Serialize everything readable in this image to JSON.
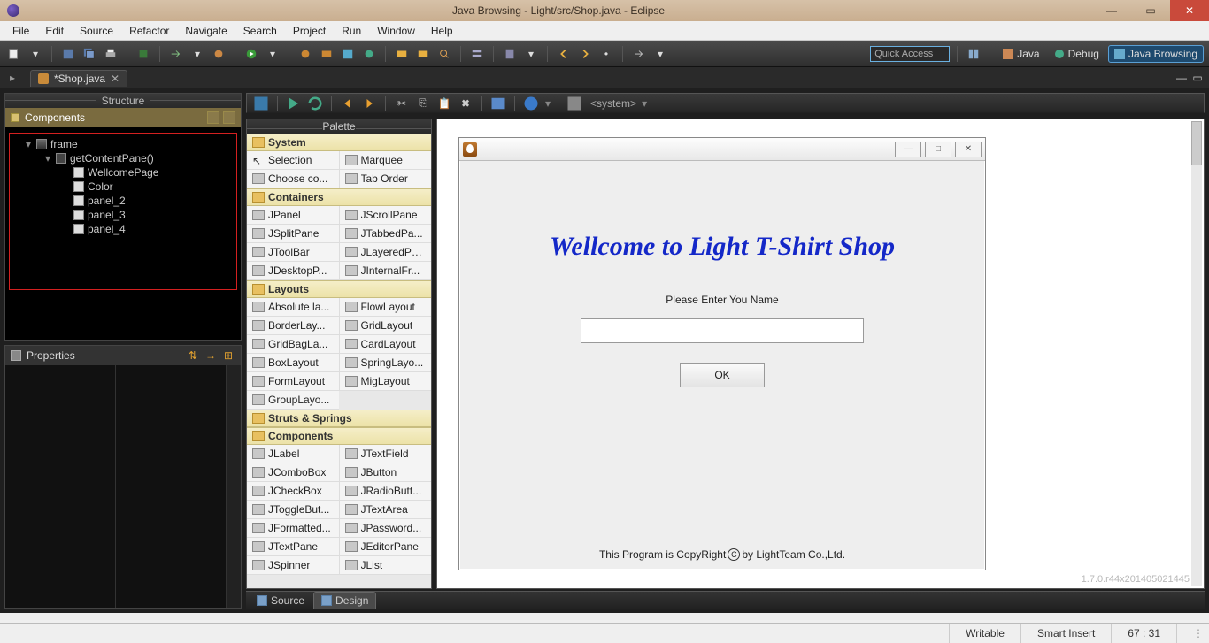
{
  "window": {
    "title": "Java Browsing - Light/src/Shop.java - Eclipse"
  },
  "menubar": [
    "File",
    "Edit",
    "Source",
    "Refactor",
    "Navigate",
    "Search",
    "Project",
    "Run",
    "Window",
    "Help"
  ],
  "quick_access_placeholder": "Quick Access",
  "perspectives": {
    "java": "Java",
    "debug": "Debug",
    "browsing": "Java Browsing"
  },
  "editor_tab": {
    "label": "*Shop.java"
  },
  "structure": {
    "title": "Structure",
    "components_label": "Components",
    "tree": {
      "frame": "frame",
      "getContentPane": "getContentPane()",
      "WellcomePage": "WellcomePage",
      "Color": "Color",
      "panel_2": "panel_2",
      "panel_3": "panel_3",
      "panel_4": "panel_4"
    }
  },
  "properties": {
    "title": "Properties"
  },
  "palette": {
    "title": "Palette",
    "categories": {
      "system": "System",
      "containers": "Containers",
      "layouts": "Layouts",
      "struts": "Struts & Springs",
      "components": "Components"
    },
    "system_items": {
      "selection": "Selection",
      "marquee": "Marquee",
      "choose": "Choose co...",
      "tab_order": "Tab Order"
    },
    "container_items": {
      "jpanel": "JPanel",
      "jscrollpane": "JScrollPane",
      "jsplitpane": "JSplitPane",
      "jtabbedpane": "JTabbedPa...",
      "jtoolbar": "JToolBar",
      "jlayeredpane": "JLayeredPa...",
      "jdesktoppane": "JDesktopP...",
      "jinternalframe": "JInternalFr..."
    },
    "layout_items": {
      "absolute": "Absolute la...",
      "flow": "FlowLayout",
      "border": "BorderLay...",
      "grid": "GridLayout",
      "gridbag": "GridBagLa...",
      "card": "CardLayout",
      "box": "BoxLayout",
      "spring": "SpringLayo...",
      "form": "FormLayout",
      "mig": "MigLayout",
      "group": "GroupLayo..."
    },
    "component_items": {
      "jlabel": "JLabel",
      "jtextfield": "JTextField",
      "jcombobox": "JComboBox",
      "jbutton": "JButton",
      "jcheckbox": "JCheckBox",
      "jradiobutton": "JRadioButt...",
      "jtogglebutton": "JToggleBut...",
      "jtextarea": "JTextArea",
      "jformatted": "JFormatted...",
      "jpassword": "JPassword...",
      "jtextpane": "JTextPane",
      "jeditorpane": "JEditorPane",
      "jspinner": "JSpinner",
      "jlist": "JList"
    }
  },
  "design_toolbar": {
    "system_label": "<system>"
  },
  "app_preview": {
    "welcome": "Wellcome to Light T-Shirt Shop",
    "prompt": "Please Enter You Name",
    "ok": "OK",
    "footer_pre": "This Program is CopyRight ",
    "footer_c": "C",
    "footer_post": " by LightTeam Co.,Ltd."
  },
  "version": "1.7.0.r44x201405021445",
  "bottom_tabs": {
    "source": "Source",
    "design": "Design"
  },
  "statusbar": {
    "writable": "Writable",
    "insert": "Smart Insert",
    "pos": "67 : 31"
  }
}
